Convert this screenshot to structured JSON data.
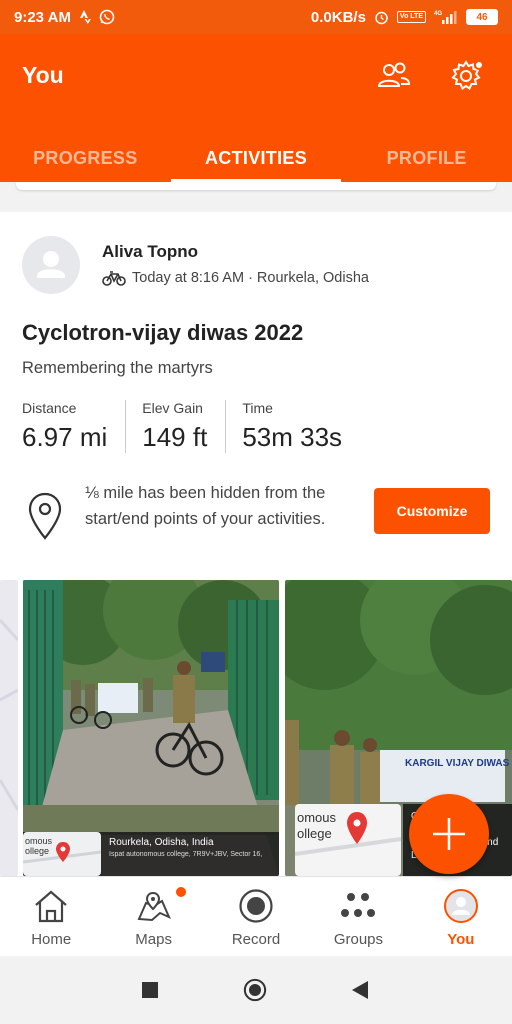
{
  "status_bar": {
    "time": "9:23 AM",
    "network_speed": "0.0KB/s",
    "volte": "Vo LTE",
    "signal": "4G",
    "battery": "46"
  },
  "header": {
    "title": "You",
    "friends_icon": "friends-icon",
    "settings_icon": "gear-icon"
  },
  "tabs": [
    {
      "label": "PROGRESS",
      "active": false
    },
    {
      "label": "ACTIVITIES",
      "active": true
    },
    {
      "label": "PROFILE",
      "active": false
    }
  ],
  "activity": {
    "athlete_name": "Aliva Topno",
    "meta": "Today at 8:16 AM · Rourkela, Odisha",
    "title": "Cyclotron-vijay diwas 2022",
    "description": "Remembering the martyrs",
    "stats": [
      {
        "label": "Distance",
        "value": "6.97 mi"
      },
      {
        "label": "Elev Gain",
        "value": "149 ft"
      },
      {
        "label": "Time",
        "value": "53m 33s"
      }
    ],
    "privacy_text": "⅛ mile has been hidden from the start/end points of your activities.",
    "customize_label": "Customize"
  },
  "photos": {
    "photo1_map_label": "omous\nollege",
    "photo1_location": "Rourkela, Odisha, India",
    "photo1_address": "Ispat autonomous college, 7R9V+JBV, Sector 16,",
    "photo2_banner": "KARGIL VIJAY DIWAS",
    "photo2_map_label": "omous\nollege",
    "photo2_line1": "Odis",
    "photo2_line2": "nomous c",
    "photo2_line3": "Odisha 770039, Ind",
    "photo2_line4": "Lat 22.268451°"
  },
  "bottom_nav": [
    {
      "label": "Home",
      "icon": "home-icon",
      "active": false
    },
    {
      "label": "Maps",
      "icon": "map-icon",
      "active": false
    },
    {
      "label": "Record",
      "icon": "record-icon",
      "active": false
    },
    {
      "label": "Groups",
      "icon": "groups-icon",
      "active": false
    },
    {
      "label": "You",
      "icon": "avatar-icon",
      "active": true
    }
  ],
  "colors": {
    "brand": "#fc5200",
    "status_bar": "#f25a0c"
  }
}
